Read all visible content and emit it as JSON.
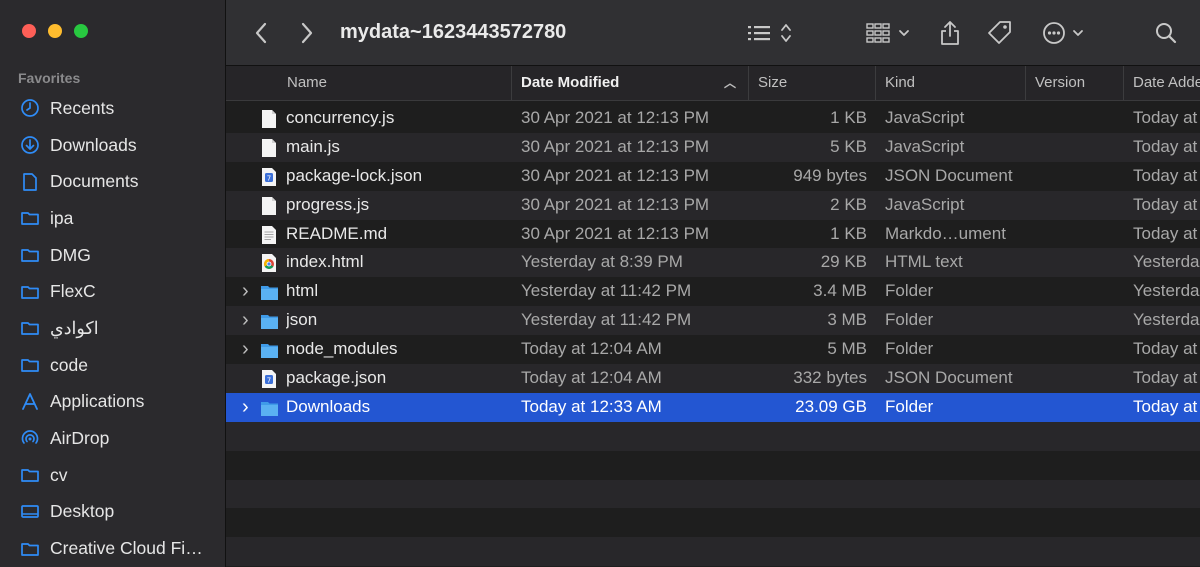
{
  "window": {
    "title": "mydata~1623443572780"
  },
  "sidebar": {
    "header": "Favorites",
    "items": [
      {
        "label": "Recents",
        "icon": "clock-icon"
      },
      {
        "label": "Downloads",
        "icon": "download-icon"
      },
      {
        "label": "Documents",
        "icon": "document-icon"
      },
      {
        "label": "ipa",
        "icon": "folder-icon"
      },
      {
        "label": "DMG",
        "icon": "folder-icon"
      },
      {
        "label": "FlexC",
        "icon": "folder-icon"
      },
      {
        "label": "اكوادي",
        "icon": "folder-icon"
      },
      {
        "label": "code",
        "icon": "folder-icon"
      },
      {
        "label": "Applications",
        "icon": "applications-icon"
      },
      {
        "label": "AirDrop",
        "icon": "airdrop-icon"
      },
      {
        "label": "cv",
        "icon": "folder-icon"
      },
      {
        "label": "Desktop",
        "icon": "desktop-icon"
      },
      {
        "label": "Creative Cloud Fi…",
        "icon": "folder-icon"
      }
    ]
  },
  "columns": {
    "name": "Name",
    "date_modified": "Date Modified",
    "size": "Size",
    "kind": "Kind",
    "version": "Version",
    "date_added": "Date Adde"
  },
  "files": [
    {
      "name": "concurrency.js",
      "date": "30 Apr 2021 at 12:13 PM",
      "size": "1 KB",
      "kind": "JavaScript",
      "added": "Today at",
      "icon": "file-icon",
      "expandable": false
    },
    {
      "name": "main.js",
      "date": "30 Apr 2021 at 12:13 PM",
      "size": "5 KB",
      "kind": "JavaScript",
      "added": "Today at",
      "icon": "file-icon",
      "expandable": false
    },
    {
      "name": "package-lock.json",
      "date": "30 Apr 2021 at 12:13 PM",
      "size": "949 bytes",
      "kind": "JSON Document",
      "added": "Today at",
      "icon": "json-file-icon",
      "expandable": false
    },
    {
      "name": "progress.js",
      "date": "30 Apr 2021 at 12:13 PM",
      "size": "2 KB",
      "kind": "JavaScript",
      "added": "Today at",
      "icon": "file-icon",
      "expandable": false
    },
    {
      "name": "README.md",
      "date": "30 Apr 2021 at 12:13 PM",
      "size": "1 KB",
      "kind": "Markdo…ument",
      "added": "Today at",
      "icon": "text-file-icon",
      "expandable": false
    },
    {
      "name": "index.html",
      "date": "Yesterday at 8:39 PM",
      "size": "29 KB",
      "kind": "HTML text",
      "added": "Yesterda",
      "icon": "chrome-file-icon",
      "expandable": false
    },
    {
      "name": "html",
      "date": "Yesterday at 11:42 PM",
      "size": "3.4 MB",
      "kind": "Folder",
      "added": "Yesterda",
      "icon": "folder-icon",
      "expandable": true
    },
    {
      "name": "json",
      "date": "Yesterday at 11:42 PM",
      "size": "3 MB",
      "kind": "Folder",
      "added": "Yesterda",
      "icon": "folder-icon",
      "expandable": true
    },
    {
      "name": "node_modules",
      "date": "Today at 12:04 AM",
      "size": "5 MB",
      "kind": "Folder",
      "added": "Today at",
      "icon": "folder-icon",
      "expandable": true
    },
    {
      "name": "package.json",
      "date": "Today at 12:04 AM",
      "size": "332 bytes",
      "kind": "JSON Document",
      "added": "Today at",
      "icon": "json-file-icon",
      "expandable": false
    },
    {
      "name": "Downloads",
      "date": "Today at 12:33 AM",
      "size": "23.09 GB",
      "kind": "Folder",
      "added": "Today at",
      "icon": "folder-icon",
      "expandable": true,
      "selected": true
    }
  ],
  "colors": {
    "selection": "#2356d2",
    "folder": "#4aa6ef",
    "accent": "#2f8cf7"
  }
}
